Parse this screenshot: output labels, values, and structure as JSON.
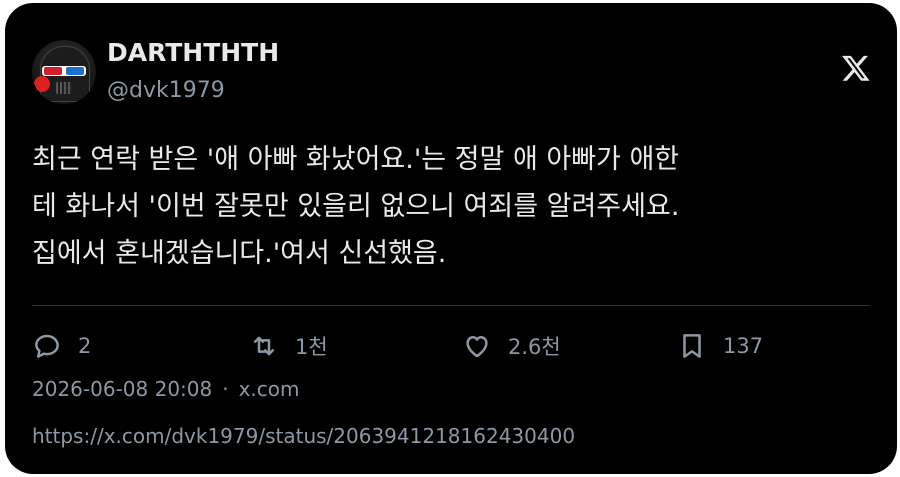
{
  "author": {
    "display_name": "DARTHTHTH",
    "handle": "@dvk1979",
    "avatar_icon": "darth-vader-3d-glasses-avatar"
  },
  "platform_icon": "x-logo-icon",
  "tweet": {
    "lines": [
      "최근 연락 받은 '애 아빠 화났어요.'는 정말 애 아빠가 애한",
      "테 화나서 '이번 잘못만 있을리 없으니 여죄를 알려주세요.",
      "집에서 혼내겠습니다.'여서 신선했음."
    ]
  },
  "actions": {
    "reply": {
      "icon": "reply-icon",
      "count": "2"
    },
    "retweet": {
      "icon": "retweet-icon",
      "count": "1천"
    },
    "like": {
      "icon": "heart-icon",
      "count": "2.6천"
    },
    "bookmark": {
      "icon": "bookmark-icon",
      "count": "137"
    }
  },
  "meta": {
    "timestamp": "2026-06-08 20:08",
    "separator": "·",
    "source": "x.com"
  },
  "permalink": "https://x.com/dvk1979/status/2063941218162430400",
  "colors": {
    "background": "#000000",
    "text_primary": "#e7e9ea",
    "text_secondary": "#8b98a5",
    "divider": "#2f3336"
  }
}
